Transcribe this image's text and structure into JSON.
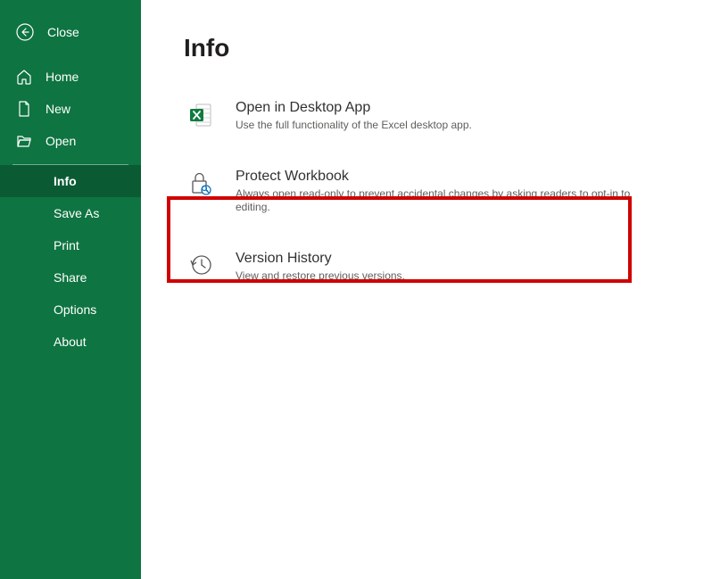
{
  "sidebar": {
    "close": "Close",
    "nav": {
      "home": "Home",
      "new": "New",
      "open": "Open"
    },
    "sub": {
      "info": "Info",
      "saveas": "Save As",
      "print": "Print",
      "share": "Share",
      "options": "Options",
      "about": "About"
    }
  },
  "main": {
    "title": "Info",
    "cards": {
      "openDesktop": {
        "title": "Open in Desktop App",
        "desc": "Use the full functionality of the Excel desktop app."
      },
      "protect": {
        "title": "Protect Workbook",
        "desc": "Always open read-only to prevent accidental changes by asking readers to opt-in to editing."
      },
      "version": {
        "title": "Version History",
        "desc": "View and restore previous versions."
      }
    }
  }
}
